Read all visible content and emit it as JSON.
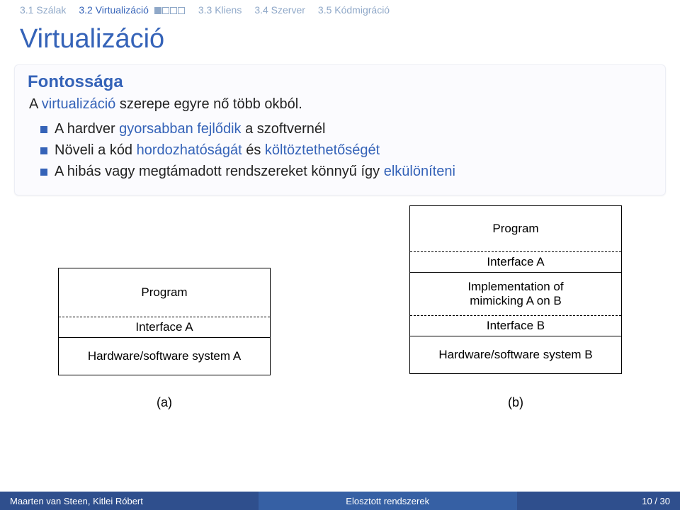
{
  "nav": {
    "items": [
      {
        "label": "3.1 Szálak"
      },
      {
        "label": "3.2 Virtualizáció",
        "active": true,
        "progress": [
          true,
          false,
          false,
          false
        ]
      },
      {
        "label": "3.3 Kliens"
      },
      {
        "label": "3.4 Szerver"
      },
      {
        "label": "3.5 Kódmigráció"
      }
    ]
  },
  "title": "Virtualizáció",
  "block": {
    "heading": "Fontossága",
    "intro_prefix": "A ",
    "intro_hl": "virtualizáció",
    "intro_suffix": " szerepe egyre nő több okból.",
    "bullets": [
      {
        "pre": "A hardver ",
        "hl": "gyorsabban fejlődik",
        "post": " a szoftvernél"
      },
      {
        "pre": "Növeli a kód ",
        "hl": "hordozhatóságát",
        "post": " és ",
        "hl2": "költöztethetőségét"
      },
      {
        "pre": "A hibás vagy megtámadott rendszereket könnyű így ",
        "hl": "elkülöníteni",
        "post": ""
      }
    ]
  },
  "diagram": {
    "left": {
      "cells": [
        "Program",
        "Interface A",
        "Hardware/software system A"
      ],
      "caption": "(a)"
    },
    "right": {
      "cells": [
        "Program",
        "Interface A",
        "Implementation of\nmimicking A on B",
        "Interface B",
        "Hardware/software system B"
      ],
      "caption": "(b)"
    }
  },
  "footer": {
    "authors": "Maarten van Steen, Kitlei Róbert",
    "course": "Elosztott rendszerek",
    "page": "10 / 30"
  }
}
